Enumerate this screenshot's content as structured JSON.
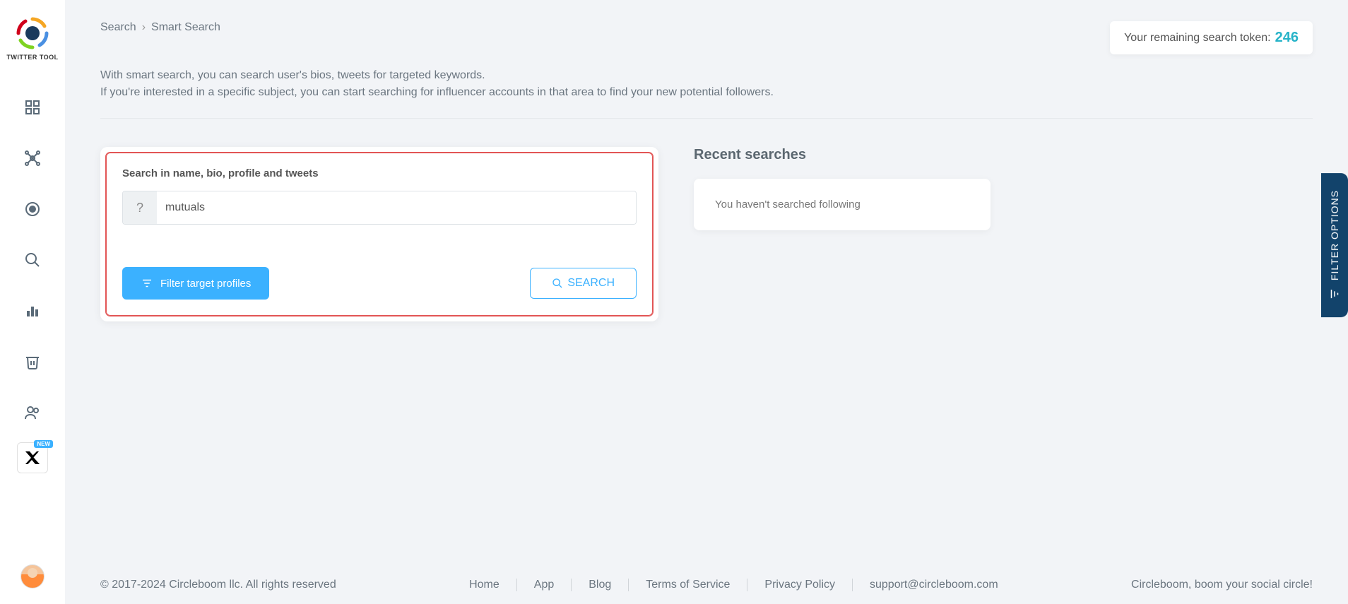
{
  "app": {
    "name": "TWITTER TOOL"
  },
  "breadcrumb": {
    "root": "Search",
    "current": "Smart Search"
  },
  "token": {
    "label": "Your remaining search token:",
    "value": "246"
  },
  "intro": {
    "line1": "With smart search, you can search user's bios, tweets for targeted keywords.",
    "line2": "If you're interested in a specific subject, you can start searching for influencer accounts in that area to find your new potential followers."
  },
  "search": {
    "label": "Search in name, bio, profile and tweets",
    "prefix": "?",
    "value": "mutuals",
    "filter_btn": "Filter target profiles",
    "search_btn": "SEARCH"
  },
  "recent": {
    "title": "Recent searches",
    "empty": "You haven't searched following"
  },
  "side_tab": "FILTER OPTIONS",
  "sidebar": {
    "new_badge": "NEW"
  },
  "footer": {
    "copyright": "© 2017-2024 Circleboom llc. All rights reserved",
    "links": [
      "Home",
      "App",
      "Blog",
      "Terms of Service",
      "Privacy Policy",
      "support@circleboom.com"
    ],
    "tagline": "Circleboom, boom your social circle!"
  }
}
